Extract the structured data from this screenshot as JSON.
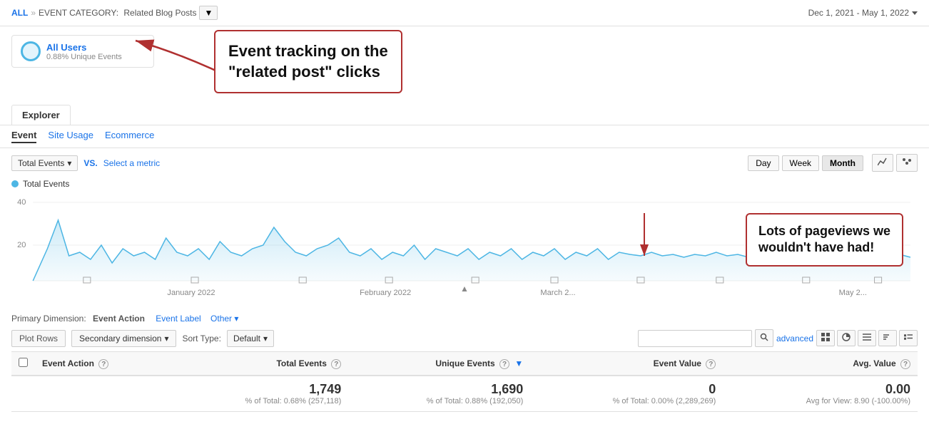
{
  "topbar": {
    "all_label": "ALL",
    "separator": "»",
    "event_category_label": "EVENT CATEGORY:",
    "event_category_value": "Related Blog Posts",
    "dropdown_arrow": "▼",
    "date_range": "Dec 1, 2021 - May 1, 2022"
  },
  "segment": {
    "name": "All Users",
    "sub": "0.88% Unique Events"
  },
  "callout1": {
    "text": "Event tracking on the\n\"related post\" clicks"
  },
  "tabs": {
    "explorer": "Explorer"
  },
  "sub_tabs": [
    {
      "label": "Event",
      "active": true
    },
    {
      "label": "Site Usage",
      "active": false
    },
    {
      "label": "Ecommerce",
      "active": false
    }
  ],
  "chart_controls": {
    "metric": "Total Events",
    "vs_label": "VS.",
    "select_metric": "Select a metric",
    "periods": [
      "Day",
      "Week",
      "Month"
    ],
    "active_period": "Month"
  },
  "chart": {
    "legend": "Total Events",
    "y_labels": [
      "40",
      "20"
    ],
    "x_labels": [
      "January 2022",
      "February 2022",
      "March 2...",
      "May 2..."
    ]
  },
  "callout2": {
    "text": "Lots of pageviews we\nwouldn't have had!"
  },
  "primary_dim": {
    "label": "Primary Dimension:",
    "dimension": "Event Action",
    "link1": "Event Label",
    "link2": "Other"
  },
  "toolbar": {
    "plot_rows": "Plot Rows",
    "secondary_dim": "Secondary dimension",
    "sort_label": "Sort Type:",
    "sort_value": "Default",
    "advanced": "advanced",
    "search_placeholder": ""
  },
  "table": {
    "columns": [
      {
        "key": "event_action",
        "label": "Event Action",
        "help": true,
        "sortable": false
      },
      {
        "key": "total_events",
        "label": "Total Events",
        "help": true,
        "sortable": false
      },
      {
        "key": "unique_events",
        "label": "Unique Events",
        "help": true,
        "sortable": true
      },
      {
        "key": "event_value",
        "label": "Event Value",
        "help": true,
        "sortable": false
      },
      {
        "key": "avg_value",
        "label": "Avg. Value",
        "help": true,
        "sortable": false
      }
    ],
    "totals": {
      "total_events_val": "1,749",
      "total_events_pct": "% of Total: 0.68% (257,118)",
      "unique_events_val": "1,690",
      "unique_events_pct": "% of Total: 0.88% (192,050)",
      "event_value_val": "0",
      "event_value_pct": "% of Total: 0.00% (2,289,269)",
      "avg_value_val": "0.00",
      "avg_value_pct": "Avg for View: 8.90 (-100.00%)"
    }
  }
}
